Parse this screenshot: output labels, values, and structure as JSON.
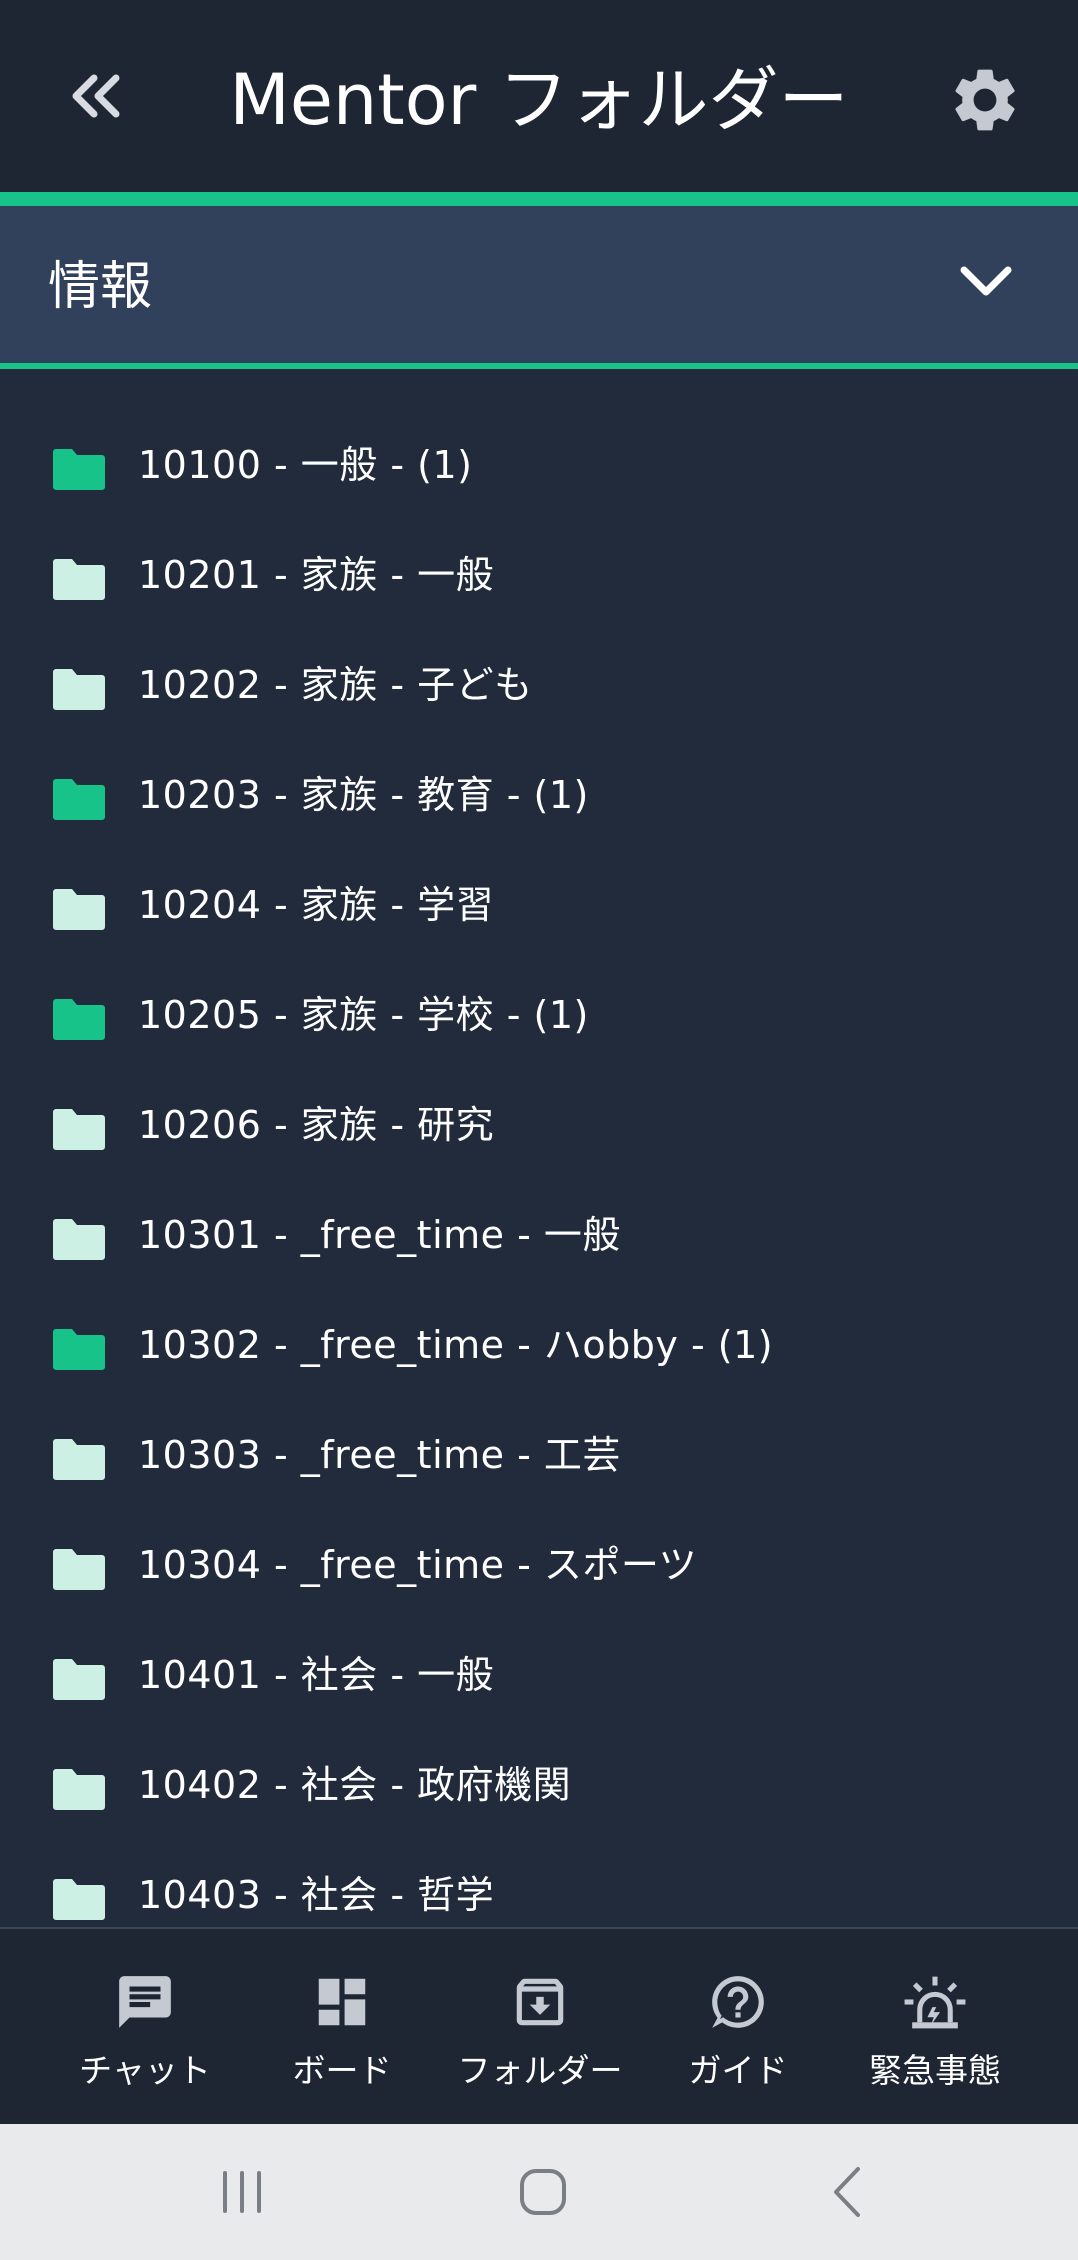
{
  "header": {
    "title": "Mentor フォルダー",
    "back_icon": "double-chevron-left-icon",
    "settings_icon": "gear-icon"
  },
  "section": {
    "label": "情報",
    "toggle_icon": "chevron-down-icon"
  },
  "colors": {
    "accent": "#17c388",
    "folder_filled": "#17c388",
    "folder_empty": "#cdf0e4",
    "background": "#222b3b",
    "header": "#1e2533",
    "section": "#31415b"
  },
  "folders": [
    {
      "label": "10100 - 一般 - (1)",
      "has_items": true
    },
    {
      "label": "10201 - 家族 - 一般",
      "has_items": false
    },
    {
      "label": "10202 - 家族 - 子ども",
      "has_items": false
    },
    {
      "label": "10203 - 家族 - 教育 - (1)",
      "has_items": true
    },
    {
      "label": "10204 - 家族 - 学習",
      "has_items": false
    },
    {
      "label": "10205 - 家族 - 学校 - (1)",
      "has_items": true
    },
    {
      "label": "10206 - 家族 - 研究",
      "has_items": false
    },
    {
      "label": "10301 - _free_time - 一般",
      "has_items": false
    },
    {
      "label": "10302 - _free_time - ハobby - (1)",
      "has_items": true
    },
    {
      "label": "10303 - _free_time - 工芸",
      "has_items": false
    },
    {
      "label": "10304 - _free_time - スポーツ",
      "has_items": false
    },
    {
      "label": "10401 - 社会 - 一般",
      "has_items": false
    },
    {
      "label": "10402 - 社会 - 政府機関",
      "has_items": false
    },
    {
      "label": "10403 - 社会 - 哲学",
      "has_items": false
    }
  ],
  "bottom_nav": [
    {
      "label": "チャット",
      "icon": "chat-icon"
    },
    {
      "label": "ボード",
      "icon": "dashboard-icon"
    },
    {
      "label": "フォルダー",
      "icon": "archive-icon"
    },
    {
      "label": "ガイド",
      "icon": "help-icon"
    },
    {
      "label": "緊急事態",
      "icon": "siren-icon"
    }
  ],
  "system_nav": {
    "recents_icon": "recents-icon",
    "home_icon": "home-icon",
    "back_icon": "back-icon"
  }
}
